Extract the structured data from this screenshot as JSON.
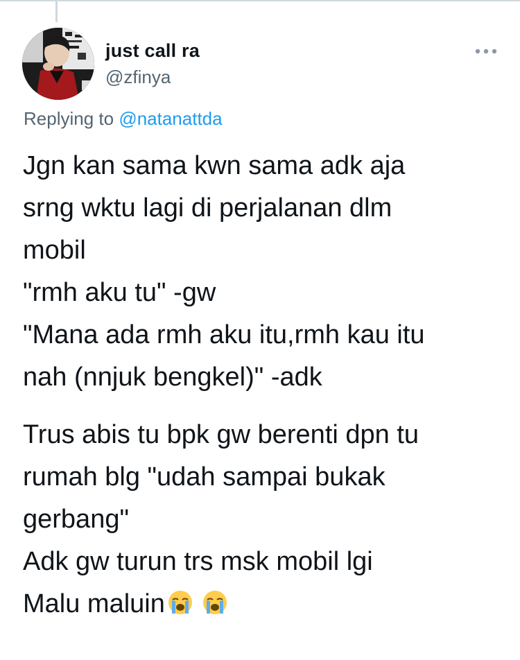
{
  "tweet": {
    "author": {
      "name": "just call ra",
      "handle": "@zfinya"
    },
    "replying": {
      "prefix": "Replying to ",
      "mention": "@natanattda"
    },
    "paragraph1": [
      "Jgn kan sama kwn sama adk aja",
      "srng wktu lagi di perjalanan dlm",
      "mobil",
      "\"rmh aku tu\" -gw",
      "\"Mana ada rmh aku itu,rmh kau itu",
      "nah (nnjuk bengkel)\" -adk"
    ],
    "paragraph2": [
      "Trus abis tu bpk gw berenti dpn tu",
      "rumah blg \"udah sampai bukak",
      "gerbang\"",
      "Adk gw turun trs msk mobil lgi"
    ],
    "last_line": "Malu maluin",
    "emojis": [
      "loudly-crying-face",
      "loudly-crying-face"
    ],
    "more_icon": "more-horizontal-icon"
  },
  "colors": {
    "text": "#0f1419",
    "secondary": "#536471",
    "link": "#1d9bf0",
    "border": "#cfd9de"
  }
}
